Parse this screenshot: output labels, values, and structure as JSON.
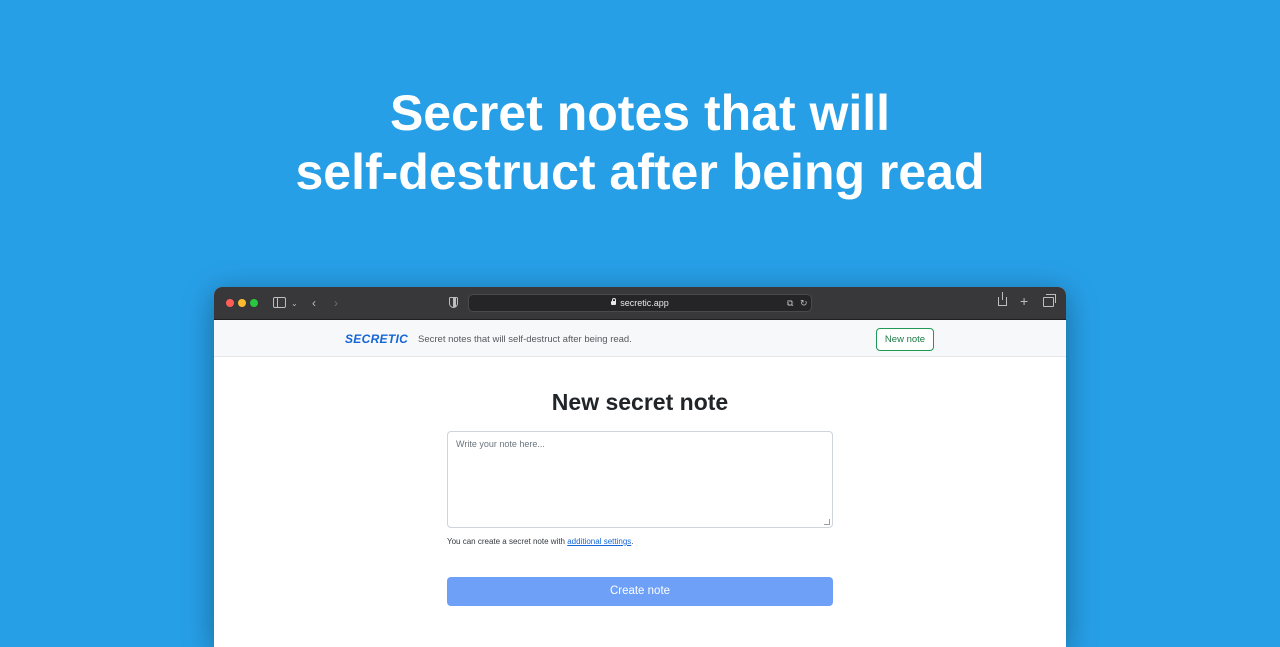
{
  "hero": {
    "line1": "Secret notes that will",
    "line2": "self-destruct after being read"
  },
  "browser": {
    "url": "secretic.app"
  },
  "app": {
    "brand": "SECRETIC",
    "tagline": "Secret notes that will self-destruct after being read.",
    "new_note_label": "New note"
  },
  "main": {
    "title": "New secret note",
    "note_placeholder": "Write your note here...",
    "hint_prefix": "You can create a secret note with ",
    "hint_link": "additional settings",
    "hint_suffix": ".",
    "create_label": "Create note"
  },
  "colors": {
    "background": "#279fe7",
    "brand": "#1566d6",
    "new_note_border": "#1d9a53",
    "create_button": "#6ea0f8"
  },
  "icons": {
    "sidebar": "sidebar-icon",
    "back": "chevron-left-icon",
    "forward": "chevron-right-icon",
    "privacy": "shield-icon",
    "lock": "lock-icon",
    "translate": "translate-icon",
    "reload": "reload-icon",
    "share": "share-icon",
    "new_tab": "plus-icon",
    "tabs": "tab-overview-icon"
  }
}
